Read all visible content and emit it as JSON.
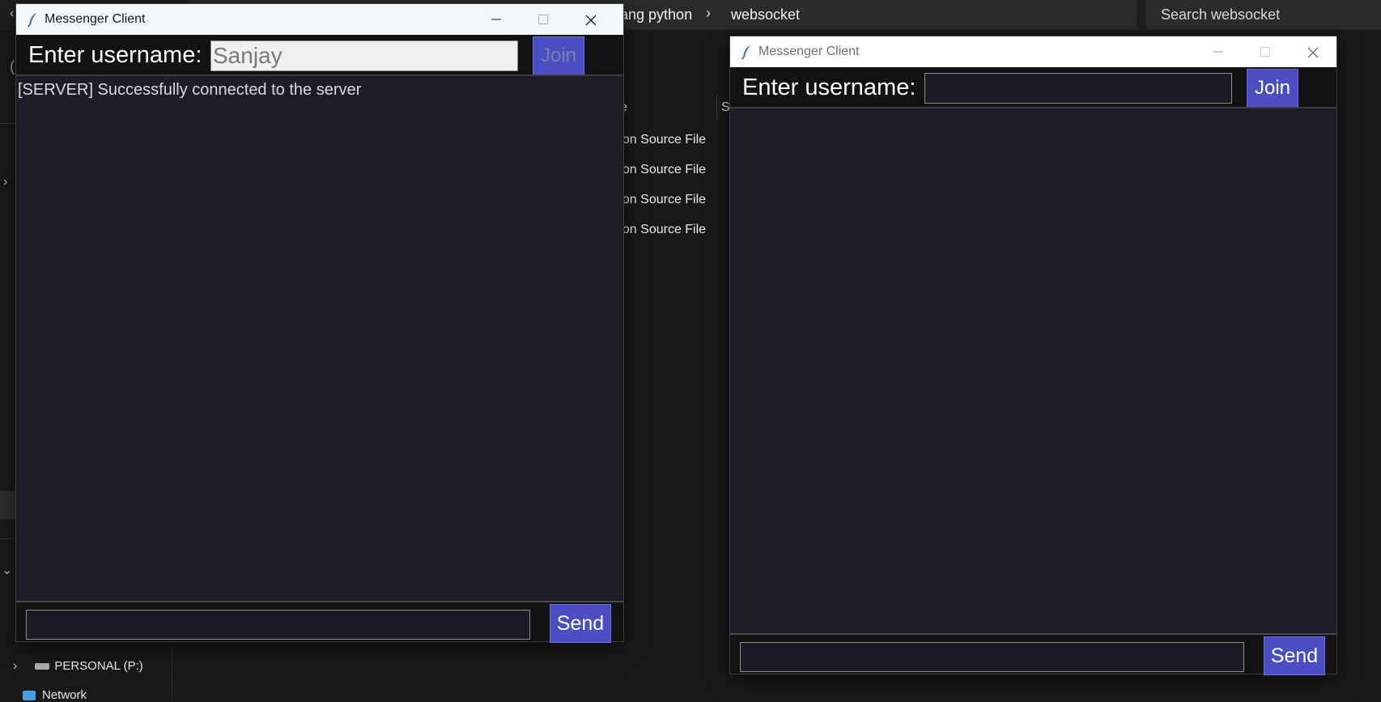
{
  "explorer": {
    "breadcrumb_partial": "ang python",
    "breadcrumb_separator": "›",
    "breadcrumb_current": "websocket",
    "search_placeholder": "Search websocket",
    "column_header_partial": "e",
    "column_header_size_partial": "S",
    "file_types": [
      "hon Source File",
      "hon Source File",
      "hon Source File",
      "hon Source File"
    ],
    "drive_label": "PERSONAL (P:)",
    "network_label_partial": "Network"
  },
  "windows": [
    {
      "title": "Messenger Client",
      "username_label": "Enter username:",
      "username_value": "Sanjay",
      "join_label": "Join",
      "chat_lines": [
        "[SERVER] Successfully connected to the server"
      ],
      "send_label": "Send",
      "message_value": ""
    },
    {
      "title": "Messenger Client",
      "username_label": "Enter username:",
      "username_value": "",
      "join_label": "Join",
      "chat_lines": [],
      "send_label": "Send",
      "message_value": ""
    }
  ],
  "colors": {
    "accent_button": "#4a4ec2",
    "chat_background": "#1f1c2a",
    "bar_background": "#121212"
  }
}
